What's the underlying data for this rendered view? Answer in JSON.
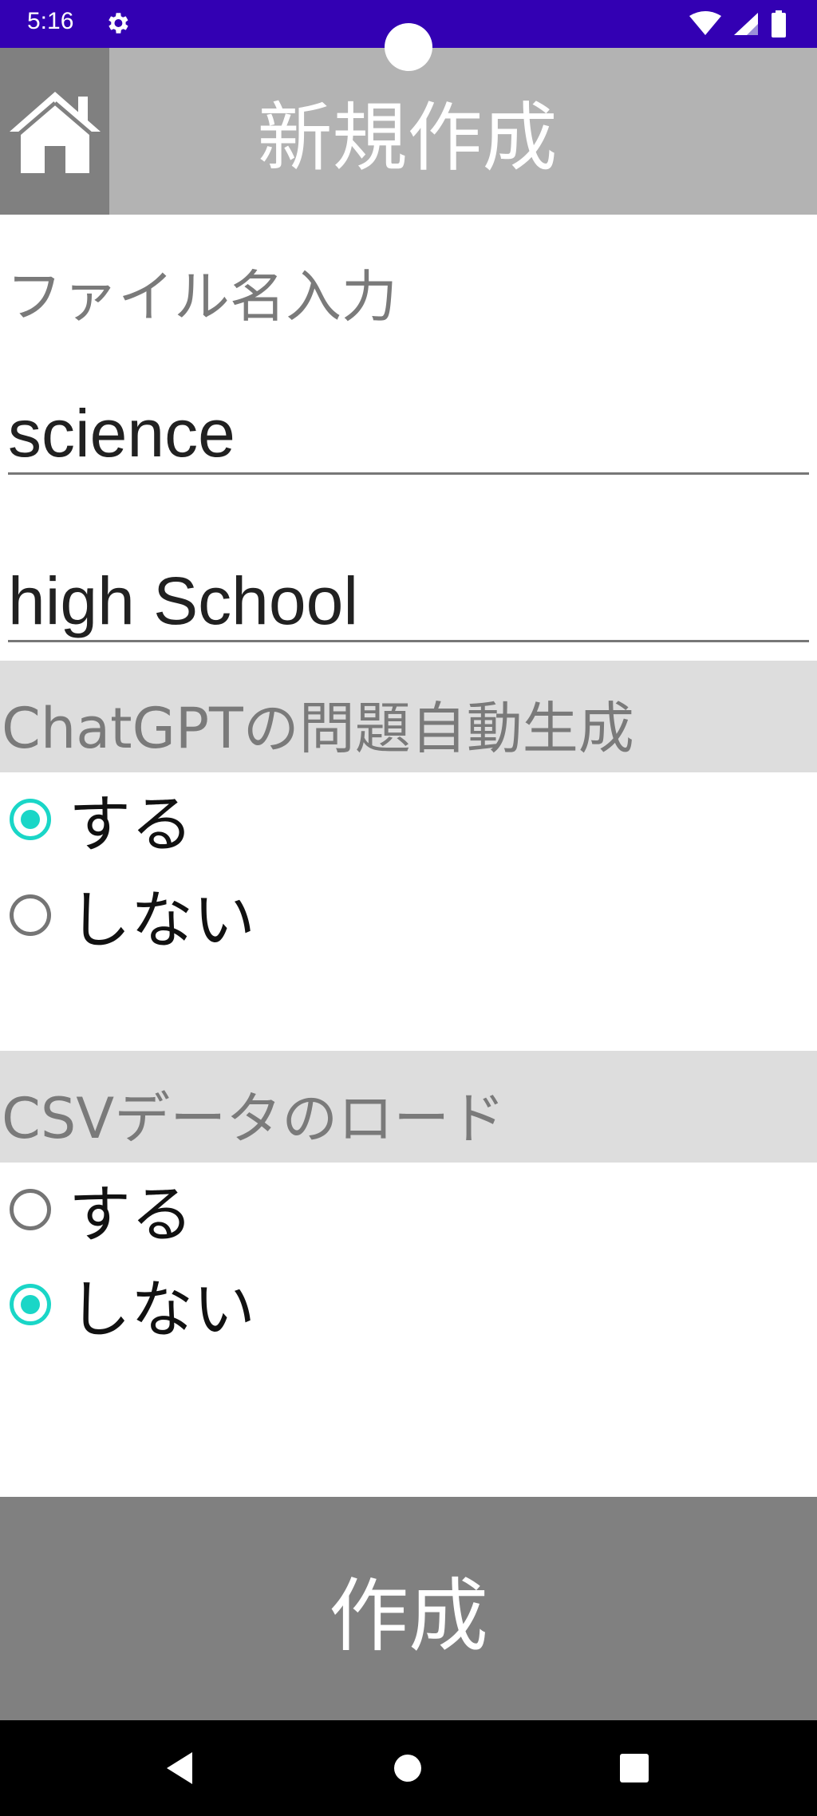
{
  "status_bar": {
    "time": "5:16",
    "icons": [
      "settings-icon",
      "wifi-icon",
      "signal-icon",
      "battery-icon"
    ],
    "color": "#3300b3"
  },
  "header": {
    "title": "新規作成",
    "home_icon": "home-icon",
    "background": "#b3b3b3"
  },
  "form": {
    "file_name_label": "ファイル名入力",
    "field_1_value": "science",
    "field_2_value": "high School"
  },
  "chatgpt_section": {
    "title": "ChatGPTの問題自動生成",
    "options": [
      {
        "label": "する",
        "checked": true
      },
      {
        "label": "しない",
        "checked": false
      }
    ]
  },
  "csv_section": {
    "title": "CSVデータのロード",
    "options": [
      {
        "label": "する",
        "checked": false
      },
      {
        "label": "しない",
        "checked": true
      }
    ]
  },
  "create_button": {
    "label": "作成"
  },
  "nav_bar": {
    "icons": [
      "back-icon",
      "home-circle-icon",
      "recents-icon"
    ]
  },
  "colors": {
    "accent": "#1ad6c7",
    "button": "#808080",
    "section_bg": "#dddddd"
  }
}
